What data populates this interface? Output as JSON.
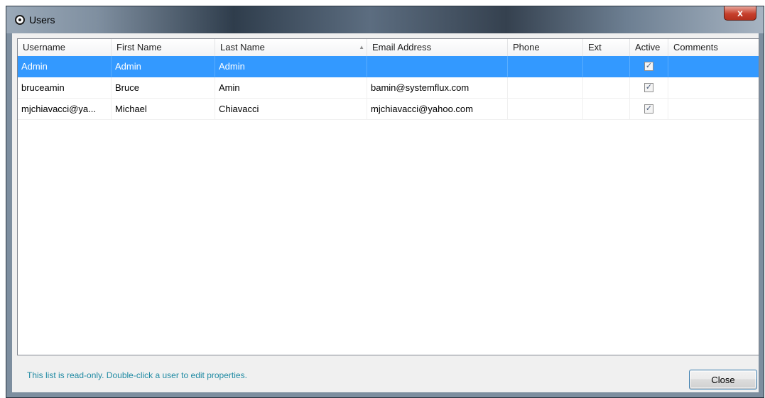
{
  "window": {
    "title": "Users",
    "close_glyph": "x"
  },
  "columns": [
    {
      "label": "Username"
    },
    {
      "label": "First Name"
    },
    {
      "label": "Last Name",
      "sort_indicator": "▲"
    },
    {
      "label": "Email Address"
    },
    {
      "label": "Phone"
    },
    {
      "label": "Ext"
    },
    {
      "label": "Active"
    },
    {
      "label": "Comments"
    }
  ],
  "rows": [
    {
      "username": "Admin",
      "first_name": "Admin",
      "last_name": "Admin",
      "email": "",
      "phone": "",
      "ext": "",
      "active": true,
      "active_mark": "✓",
      "comments": "",
      "selected": true
    },
    {
      "username": "bruceamin",
      "first_name": "Bruce",
      "last_name": "Amin",
      "email": "bamin@systemflux.com",
      "phone": "",
      "ext": "",
      "active": true,
      "active_mark": "✓",
      "comments": "",
      "selected": false
    },
    {
      "username": "mjchiavacci@ya...",
      "first_name": "Michael",
      "last_name": "Chiavacci",
      "email": "mjchiavacci@yahoo.com",
      "phone": "",
      "ext": "",
      "active": true,
      "active_mark": "✓",
      "comments": "",
      "selected": false
    }
  ],
  "status_text": "This list is read-only. Double-click a user to edit properties.",
  "buttons": {
    "close": "Close"
  },
  "colors": {
    "selection": "#3399ff",
    "status_text": "#1f8aa3",
    "close_button": "#c7402d"
  }
}
